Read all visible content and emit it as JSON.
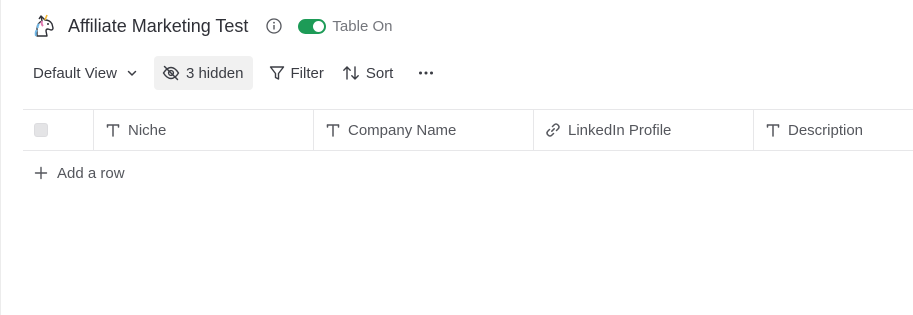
{
  "header": {
    "title": "Affiliate Marketing Test",
    "icon": "unicorn-icon",
    "toggle_label": "Table On",
    "toggle_on": true,
    "toggle_color": "#1d9b57"
  },
  "toolbar": {
    "view_label": "Default View",
    "hidden_label": "3 hidden",
    "filter_label": "Filter",
    "sort_label": "Sort"
  },
  "table": {
    "columns": [
      {
        "label": "Niche",
        "type_icon": "text-type-icon"
      },
      {
        "label": "Company Name",
        "type_icon": "text-type-icon"
      },
      {
        "label": "LinkedIn Profile",
        "type_icon": "link-icon"
      },
      {
        "label": "Description",
        "type_icon": "text-type-icon"
      }
    ],
    "add_row_label": "Add a row"
  }
}
